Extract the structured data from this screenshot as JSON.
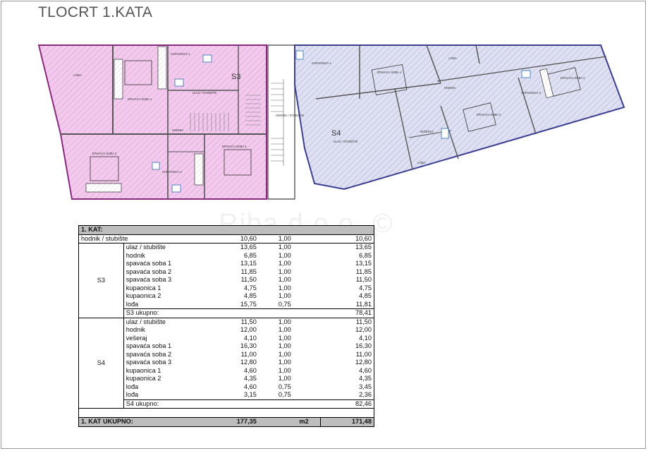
{
  "title": "TLOCRT 1.KATA",
  "watermark": "Riba d.o.o. ©",
  "plan": {
    "s3_label": "S3",
    "s4_label": "S4",
    "rooms": [
      {
        "id": "s3-loda",
        "name": "LOĐA"
      },
      {
        "id": "s3-spavaca-1",
        "name": "SPAVAĆA SOBA 1"
      },
      {
        "id": "s3-kupaonica-1",
        "name": "KUPAONICA 1"
      },
      {
        "id": "s3-ulaz",
        "name": "ULAZ / STUBIŠTE"
      },
      {
        "id": "s3-hodnik",
        "name": "HODNIK"
      },
      {
        "id": "s3-spavaca-2",
        "name": "SPAVAĆA SOBA 2"
      },
      {
        "id": "s3-kupaonica-2",
        "name": "KUPAONICA 2"
      },
      {
        "id": "s3-spavaca-3",
        "name": "SPAVAĆA SOBA 3"
      },
      {
        "id": "common-hodnik",
        "name": "HODNIK / STUBIŠTE"
      },
      {
        "id": "s4-kupaonica-1",
        "name": "KUPAONICA 1"
      },
      {
        "id": "s4-spavaca-1",
        "name": "SPAVAĆA SOBA 1"
      },
      {
        "id": "s4-loda-1",
        "name": "LOĐA"
      },
      {
        "id": "s4-hodnik",
        "name": "HODNIK"
      },
      {
        "id": "s4-kupaonica-2",
        "name": "KUPAONICA 2"
      },
      {
        "id": "s4-spavaca-3",
        "name": "SPAVAĆA SOBA 3"
      },
      {
        "id": "s4-ulaz",
        "name": "ULAZ / STUBIŠTE"
      },
      {
        "id": "s4-veseraj",
        "name": "VEŠERAJ"
      },
      {
        "id": "s4-spavaca-2",
        "name": "SPAVAĆA SOBA 2"
      },
      {
        "id": "s4-loda-2",
        "name": "LOĐA"
      }
    ],
    "colors": {
      "s3_fill": "#f3c9ee",
      "s3_stroke": "#b43aa5",
      "s4_fill": "#d9dcf0",
      "s4_stroke": "#4a4fa6"
    }
  },
  "table": {
    "header": "1. KAT:",
    "common": {
      "name": "hodnik / stubište",
      "area": "10,60",
      "coef": "1,00",
      "net": "10,60"
    },
    "groups": [
      {
        "label": "S3",
        "rows": [
          {
            "name": "ulaz / stubište",
            "area": "13,65",
            "coef": "1,00",
            "net": "13,65"
          },
          {
            "name": "hodnik",
            "area": "6,85",
            "coef": "1,00",
            "net": "6,85"
          },
          {
            "name": "spavaća soba 1",
            "area": "13,15",
            "coef": "1,00",
            "net": "13,15"
          },
          {
            "name": "spavaća soba 2",
            "area": "11,85",
            "coef": "1,00",
            "net": "11,85"
          },
          {
            "name": "spavaća soba 3",
            "area": "11,50",
            "coef": "1,00",
            "net": "11,50"
          },
          {
            "name": "kupaonica 1",
            "area": "4,75",
            "coef": "1,00",
            "net": "4,75"
          },
          {
            "name": "kupaonica 2",
            "area": "4,85",
            "coef": "1,00",
            "net": "4,85"
          },
          {
            "name": "lođa",
            "area": "15,75",
            "coef": "0,75",
            "net": "11,81"
          }
        ],
        "subtotal_label": "S3 ukupno:",
        "subtotal": "78,41"
      },
      {
        "label": "S4",
        "rows": [
          {
            "name": "ulaz / stubište",
            "area": "11,50",
            "coef": "1,00",
            "net": "11,50"
          },
          {
            "name": "hodnik",
            "area": "12,00",
            "coef": "1,00",
            "net": "12,00"
          },
          {
            "name": "vešeraj",
            "area": "4,10",
            "coef": "1,00",
            "net": "4,10"
          },
          {
            "name": "spavaća soba 1",
            "area": "16,30",
            "coef": "1,00",
            "net": "16,30"
          },
          {
            "name": "spavaća soba 2",
            "area": "11,00",
            "coef": "1,00",
            "net": "11,00"
          },
          {
            "name": "spavaća soba 3",
            "area": "12,80",
            "coef": "1,00",
            "net": "12,80"
          },
          {
            "name": "kupaonica 1",
            "area": "4,60",
            "coef": "1,00",
            "net": "4,60"
          },
          {
            "name": "kupaonica 2",
            "area": "4,35",
            "coef": "1,00",
            "net": "4,35"
          },
          {
            "name": "lođa",
            "area": "4,60",
            "coef": "0,75",
            "net": "3,45"
          },
          {
            "name": "lođa",
            "area": "3,15",
            "coef": "0,75",
            "net": "2,36"
          }
        ],
        "subtotal_label": "S4 ukupno:",
        "subtotal": "82,46"
      }
    ],
    "total": {
      "label": "1. KAT UKUPNO:",
      "area": "177,35",
      "unit": "m2",
      "net": "171,48"
    }
  }
}
